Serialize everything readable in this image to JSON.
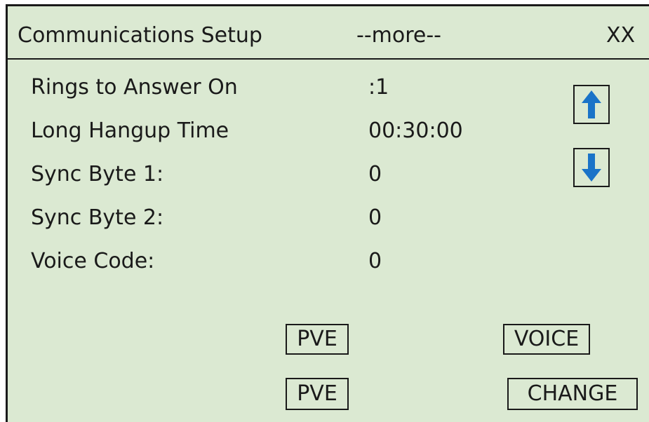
{
  "header": {
    "title": "Communications Setup",
    "more": "--more--",
    "corner": "XX"
  },
  "fields": [
    {
      "label": "Rings to Answer On",
      "value": ":1"
    },
    {
      "label": "Long Hangup Time",
      "value": "00:30:00"
    },
    {
      "label": "Sync Byte 1:",
      "value": "0"
    },
    {
      "label": "Sync Byte 2:",
      "value": "0"
    },
    {
      "label": "Voice Code:",
      "value": "0"
    }
  ],
  "nav": {
    "up_icon": "arrow-up-icon",
    "down_icon": "arrow-down-icon"
  },
  "buttons": {
    "pve_top": "PVE",
    "voice": "VOICE",
    "pve_bottom": "PVE",
    "change": "CHANGE"
  },
  "colors": {
    "background": "#dbe9d2",
    "arrow": "#1a73c8",
    "border": "#1a1a1a"
  }
}
